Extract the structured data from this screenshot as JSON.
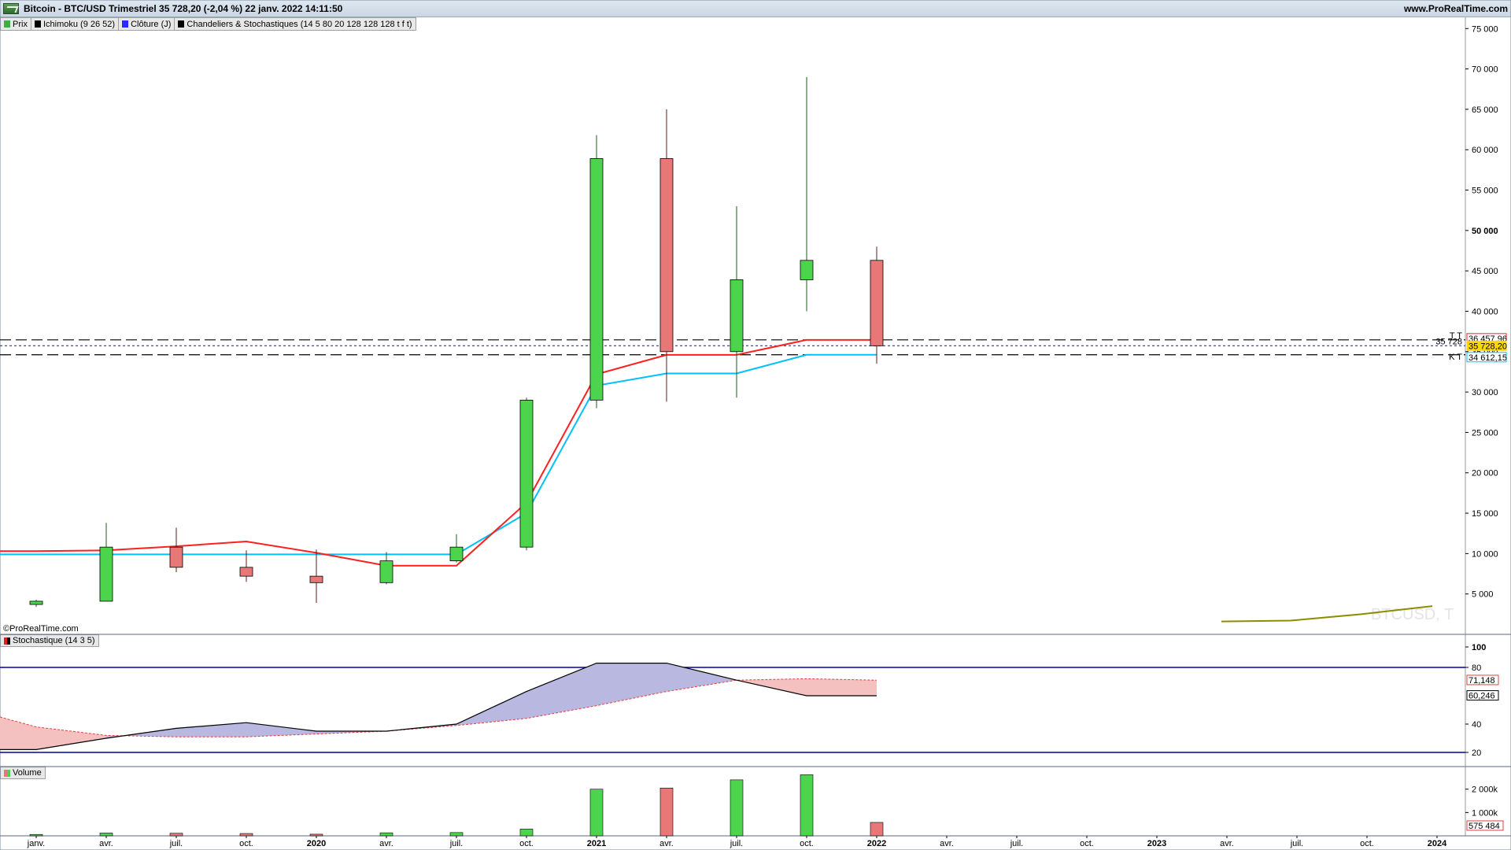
{
  "header": {
    "title": "Bitcoin - BTC/USD Trimestriel 35 728,20 (-2,04 %) 22 janv. 2022 14:11:50",
    "site": "www.ProRealTime.com"
  },
  "legend": [
    {
      "label": "Prix",
      "color": "#3cb043"
    },
    {
      "label": "Ichimoku (9 26 52)",
      "color": "#000000"
    },
    {
      "label": "Clôture (J)",
      "color": "#2a2aff"
    },
    {
      "label": "Chandeliers & Stochastiques (14 5 80 20 128 128 128 t f t)",
      "color": "#000000"
    }
  ],
  "credit": "©ProRealTime.com",
  "watermark": "BTCUSD, T",
  "stoch_panel": {
    "label": "Stochastique (14 3 5)"
  },
  "volume_panel": {
    "label": "Volume"
  },
  "colors": {
    "up": "#4cd44c",
    "down": "#e87878",
    "tenkan": "#ff2020",
    "kijun": "#00c0ff",
    "stoch_k": "#000000",
    "stoch_d": "#e04040",
    "band": "#0000a0",
    "chikou": "#8c8c00"
  },
  "chart_data": [
    {
      "type": "candlestick",
      "title": "Bitcoin - BTC/USD Trimestriel",
      "x": [
        "janv.",
        "avr.",
        "juil.",
        "oct.",
        "2020",
        "avr.",
        "juil.",
        "oct.",
        "2021",
        "avr.",
        "juil.",
        "oct.",
        "2022"
      ],
      "candles": [
        {
          "open": 3700,
          "high": 4300,
          "low": 3400,
          "close": 4100
        },
        {
          "open": 4100,
          "high": 13800,
          "low": 4100,
          "close": 10800
        },
        {
          "open": 10800,
          "high": 13200,
          "low": 7700,
          "close": 8300
        },
        {
          "open": 8300,
          "high": 10400,
          "low": 6500,
          "close": 7200
        },
        {
          "open": 7200,
          "high": 10500,
          "low": 3900,
          "close": 6400
        },
        {
          "open": 6400,
          "high": 10200,
          "low": 6200,
          "close": 9100
        },
        {
          "open": 9100,
          "high": 12400,
          "low": 8900,
          "close": 10800
        },
        {
          "open": 10800,
          "high": 29300,
          "low": 10400,
          "close": 29000
        },
        {
          "open": 29000,
          "high": 61800,
          "low": 28000,
          "close": 58900
        },
        {
          "open": 58900,
          "high": 65000,
          "low": 28800,
          "close": 35000
        },
        {
          "open": 35000,
          "high": 53000,
          "low": 29300,
          "close": 43900
        },
        {
          "open": 43900,
          "high": 69000,
          "low": 40000,
          "close": 46300
        },
        {
          "open": 46300,
          "high": 48000,
          "low": 33500,
          "close": 35728
        }
      ],
      "tenkan": [
        10300,
        10300,
        10400,
        10900,
        11500,
        10100,
        8500,
        8500,
        16300,
        32200,
        34600,
        34600,
        36458,
        36458
      ],
      "kijun": [
        9900,
        9900,
        9900,
        9900,
        9900,
        9900,
        9900,
        9900,
        15000,
        30800,
        32300,
        32300,
        34612,
        34612
      ],
      "chikou": [
        1600,
        1700,
        2500,
        3500
      ],
      "levels": [
        {
          "label": "36 457,96",
          "value": 36458,
          "color": "#ff2020",
          "marker": "T T"
        },
        {
          "label": "35 728,20",
          "value": 35728,
          "color": "#ffd700",
          "marker": "35 728"
        },
        {
          "label": "34 612,15",
          "value": 34612,
          "color": "#00c0ff",
          "marker": "K T"
        }
      ],
      "y_ticks": [
        "75 000",
        "70 000",
        "65 000",
        "60 000",
        "55 000",
        "50 000",
        "45 000",
        "40 000",
        "35 000",
        "30 000",
        "25 000",
        "20 000",
        "15 000",
        "10 000",
        "5 000"
      ],
      "y_tick_values": [
        75000,
        70000,
        65000,
        60000,
        55000,
        50000,
        45000,
        40000,
        35000,
        30000,
        25000,
        20000,
        15000,
        10000,
        5000
      ],
      "ylim": [
        0,
        76000
      ]
    },
    {
      "type": "line",
      "title": "Stochastique (14 3 5)",
      "k": [
        22,
        22,
        30,
        37,
        41,
        35,
        35,
        40,
        63,
        83,
        83,
        71,
        60,
        60
      ],
      "d": [
        45,
        38,
        32,
        31,
        31,
        33,
        35,
        39,
        44,
        53,
        63,
        71,
        72,
        71
      ],
      "y_ticks": [
        "100",
        "80",
        "40",
        "20"
      ],
      "y_tick_values": [
        100,
        80,
        40,
        20
      ],
      "bands": [
        80,
        20
      ],
      "labels": [
        {
          "label": "71,148",
          "value": 71.148,
          "color": "#e04040"
        },
        {
          "label": "60,246",
          "value": 60.246,
          "color": "#000000"
        }
      ],
      "ylim": [
        10,
        100
      ]
    },
    {
      "type": "bar",
      "title": "Volume",
      "values": [
        60,
        120,
        110,
        100,
        70,
        130,
        140,
        290,
        2000,
        2050,
        2400,
        2620,
        575
      ],
      "up": [
        true,
        true,
        false,
        false,
        false,
        true,
        true,
        true,
        true,
        false,
        true,
        true,
        false
      ],
      "y_ticks": [
        "2 000k",
        "1 000k"
      ],
      "y_tick_values": [
        2000,
        1000
      ],
      "label": {
        "text": "575 484",
        "color": "#e04040"
      },
      "ylim": [
        0,
        2700
      ]
    }
  ],
  "x_axis": {
    "labels": [
      "janv.",
      "avr.",
      "juil.",
      "oct.",
      "2020",
      "avr.",
      "juil.",
      "oct.",
      "2021",
      "avr.",
      "juil.",
      "oct.",
      "2022",
      "avr.",
      "juil.",
      "oct.",
      "2023",
      "avr.",
      "juil.",
      "oct.",
      "2024"
    ],
    "bold": [
      false,
      false,
      false,
      false,
      true,
      false,
      false,
      false,
      true,
      false,
      false,
      false,
      true,
      false,
      false,
      false,
      true,
      false,
      false,
      false,
      true
    ]
  }
}
